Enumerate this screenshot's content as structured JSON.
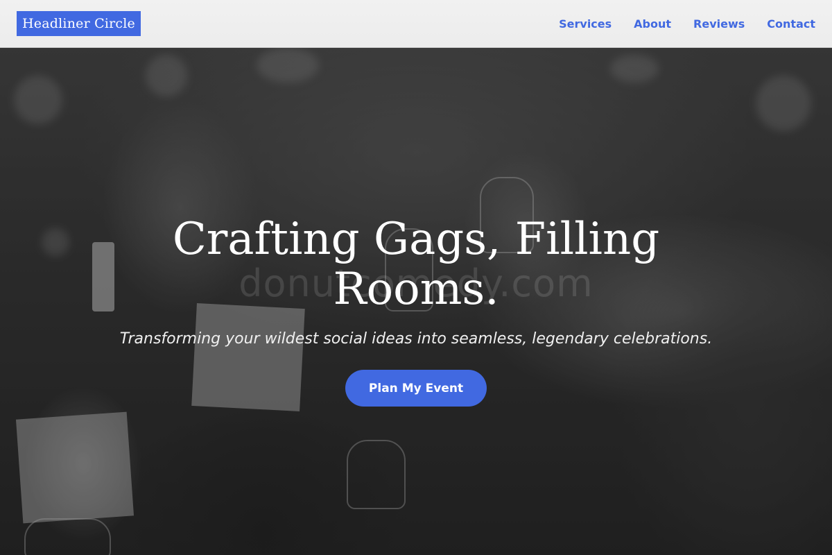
{
  "brand": {
    "name": "Headliner Circle",
    "accent_color": "#4169e1"
  },
  "nav": {
    "items": [
      {
        "label": "Services"
      },
      {
        "label": "About"
      },
      {
        "label": "Reviews"
      },
      {
        "label": "Contact"
      }
    ]
  },
  "hero": {
    "headline": "Crafting Gags, Filling Rooms.",
    "tagline": "Transforming your wildest social ideas into seamless, legendary celebrations.",
    "cta_label": "Plan My Event",
    "watermark": "donutcomedy.com",
    "background": "grayscale-banquet-toast-photo"
  }
}
